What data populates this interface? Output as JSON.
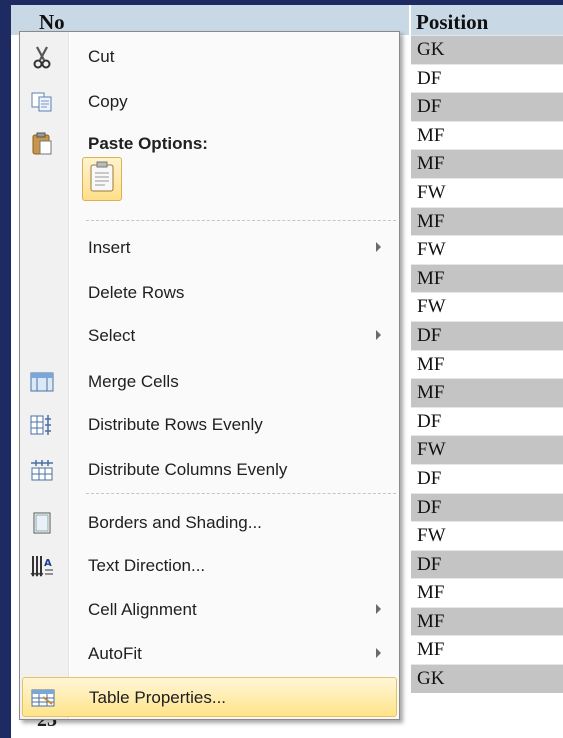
{
  "table": {
    "header_no": "No",
    "header_position": "Position",
    "last_number": "23",
    "positions": [
      "GK",
      "DF",
      "DF",
      "MF",
      "MF",
      "FW",
      "MF",
      "FW",
      "MF",
      "FW",
      "DF",
      "MF",
      "MF",
      "DF",
      "FW",
      "DF",
      "DF",
      "FW",
      "DF",
      "MF",
      "MF",
      "MF",
      "GK"
    ]
  },
  "menu": {
    "cut": "Cut",
    "copy": "Copy",
    "paste_options": "Paste Options:",
    "insert": "Insert",
    "delete_rows": "Delete Rows",
    "select": "Select",
    "merge_cells": "Merge Cells",
    "distribute_rows": "Distribute Rows Evenly",
    "distribute_columns": "Distribute Columns Evenly",
    "borders_shading": "Borders and Shading...",
    "text_direction": "Text Direction...",
    "cell_alignment": "Cell Alignment",
    "autofit": "AutoFit",
    "table_properties": "Table Properties..."
  },
  "icons": {
    "cut": "scissors-icon",
    "copy": "copy-icon",
    "paste": "clipboard-icon",
    "merge": "merge-cells-icon",
    "distribute_rows": "distribute-rows-icon",
    "distribute_columns": "distribute-columns-icon",
    "borders": "borders-shading-icon",
    "text_direction": "text-direction-icon",
    "table_properties": "table-properties-icon"
  },
  "colors": {
    "highlight": "#ffe48a",
    "header_bg": "#c8d8e4",
    "shaded_row": "#c4c4c4",
    "frame": "#1e2b63"
  }
}
